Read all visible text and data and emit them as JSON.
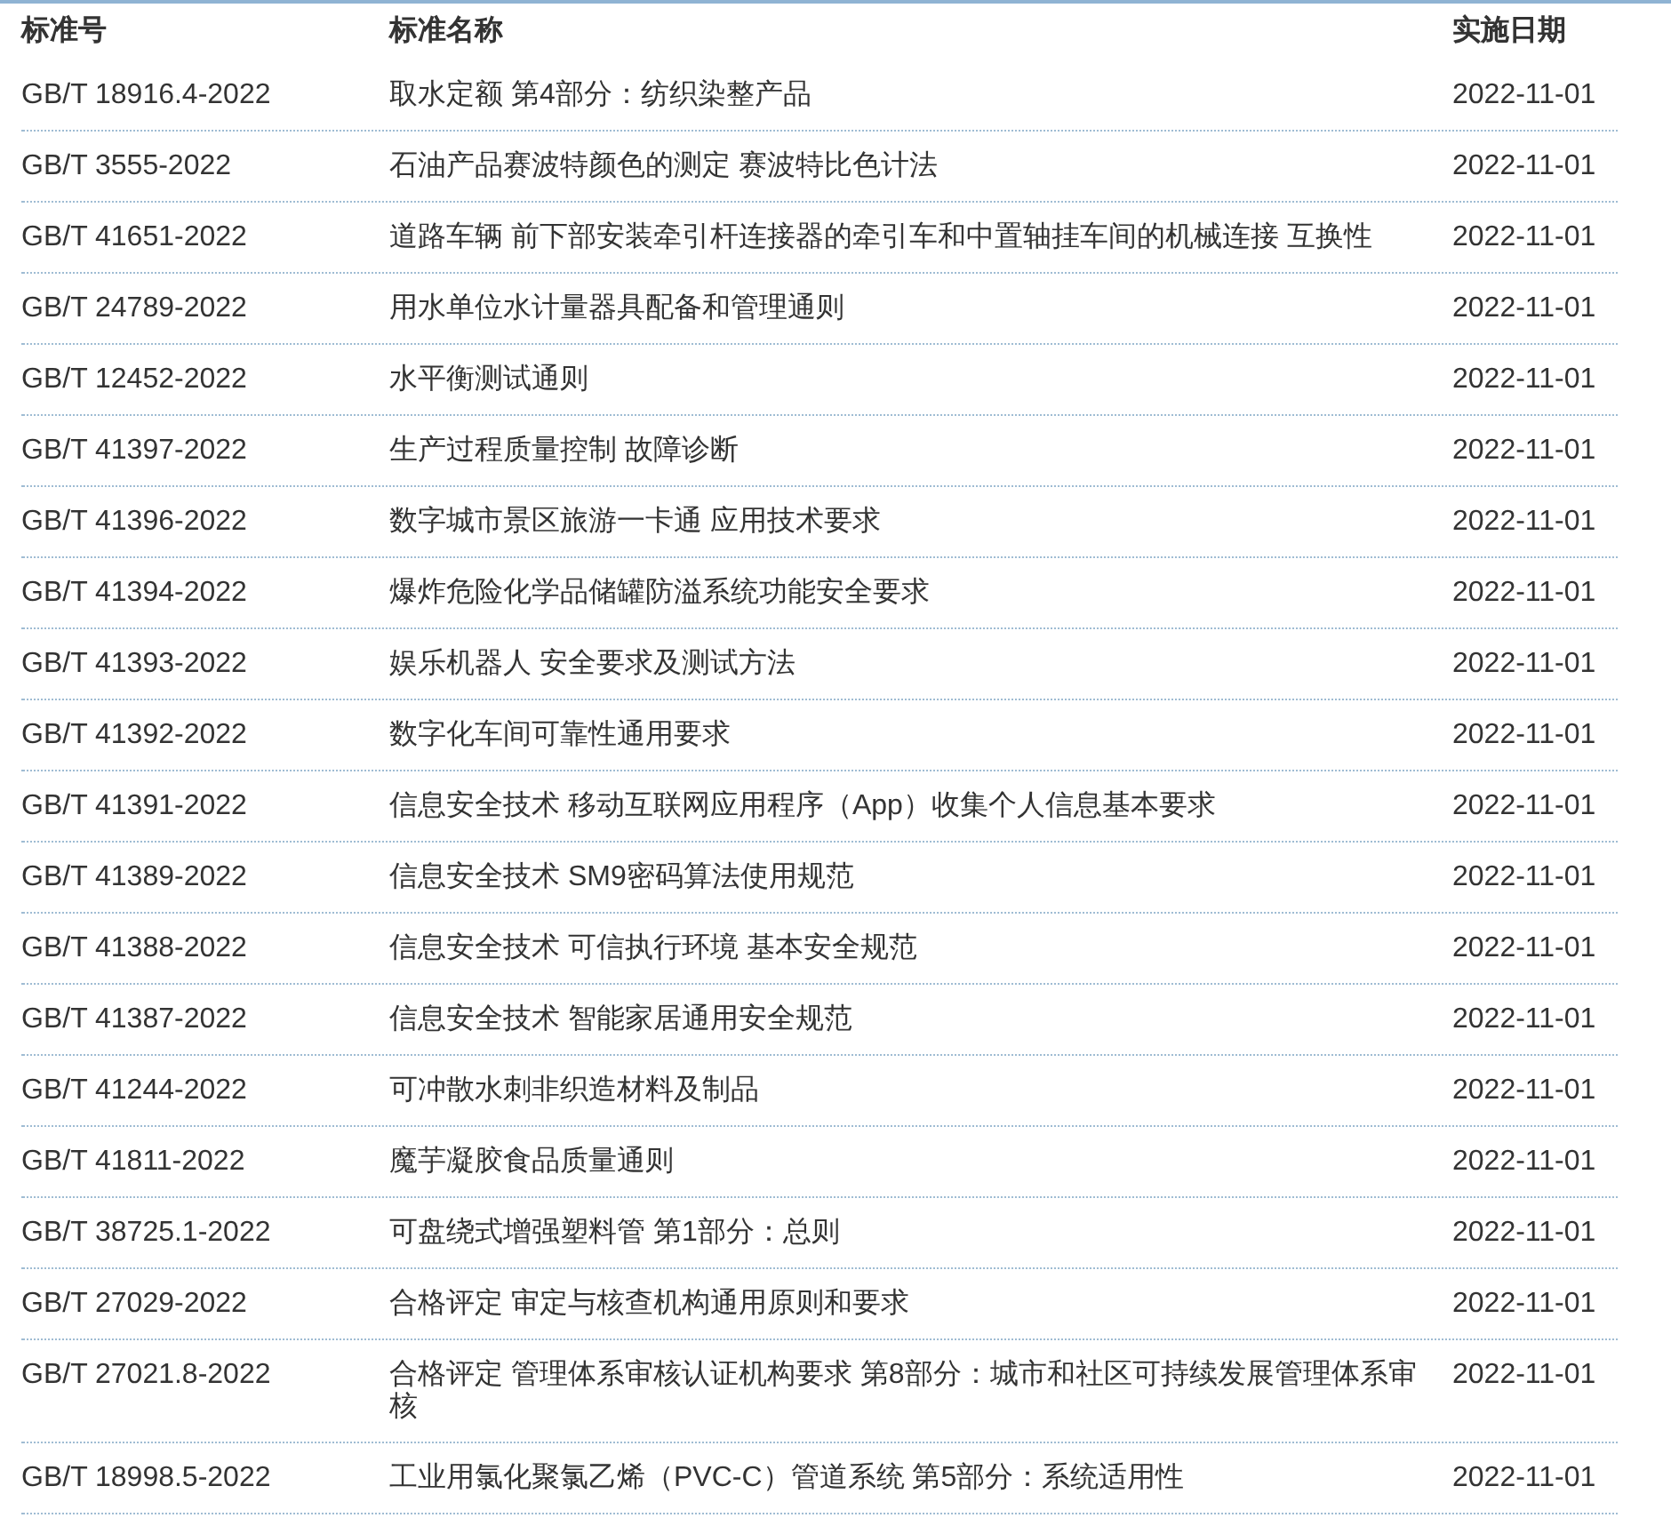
{
  "table": {
    "columns": [
      "标准号",
      "标准名称",
      "实施日期"
    ],
    "rows": [
      {
        "number": "GB/T 18916.4-2022",
        "name": "取水定额 第4部分：纺织染整产品",
        "date": "2022-11-01"
      },
      {
        "number": "GB/T 3555-2022",
        "name": "石油产品赛波特颜色的测定 赛波特比色计法",
        "date": "2022-11-01"
      },
      {
        "number": "GB/T 41651-2022",
        "name": "道路车辆 前下部安装牵引杆连接器的牵引车和中置轴挂车间的机械连接 互换性",
        "date": "2022-11-01"
      },
      {
        "number": "GB/T 24789-2022",
        "name": "用水单位水计量器具配备和管理通则",
        "date": "2022-11-01"
      },
      {
        "number": "GB/T 12452-2022",
        "name": "水平衡测试通则",
        "date": "2022-11-01"
      },
      {
        "number": "GB/T 41397-2022",
        "name": "生产过程质量控制 故障诊断",
        "date": "2022-11-01"
      },
      {
        "number": "GB/T 41396-2022",
        "name": "数字城市景区旅游一卡通 应用技术要求",
        "date": "2022-11-01"
      },
      {
        "number": "GB/T 41394-2022",
        "name": "爆炸危险化学品储罐防溢系统功能安全要求",
        "date": "2022-11-01"
      },
      {
        "number": "GB/T 41393-2022",
        "name": "娱乐机器人 安全要求及测试方法",
        "date": "2022-11-01"
      },
      {
        "number": "GB/T 41392-2022",
        "name": "数字化车间可靠性通用要求",
        "date": "2022-11-01"
      },
      {
        "number": "GB/T 41391-2022",
        "name": "信息安全技术 移动互联网应用程序（App）收集个人信息基本要求",
        "date": "2022-11-01"
      },
      {
        "number": "GB/T 41389-2022",
        "name": "信息安全技术 SM9密码算法使用规范",
        "date": "2022-11-01"
      },
      {
        "number": "GB/T 41388-2022",
        "name": "信息安全技术 可信执行环境 基本安全规范",
        "date": "2022-11-01"
      },
      {
        "number": "GB/T 41387-2022",
        "name": "信息安全技术 智能家居通用安全规范",
        "date": "2022-11-01"
      },
      {
        "number": "GB/T 41244-2022",
        "name": "可冲散水刺非织造材料及制品",
        "date": "2022-11-01"
      },
      {
        "number": "GB/T 41811-2022",
        "name": "魔芋凝胶食品质量通则",
        "date": "2022-11-01"
      },
      {
        "number": "GB/T 38725.1-2022",
        "name": "可盘绕式增强塑料管 第1部分：总则",
        "date": "2022-11-01"
      },
      {
        "number": "GB/T 27029-2022",
        "name": "合格评定 审定与核查机构通用原则和要求",
        "date": "2022-11-01"
      },
      {
        "number": "GB/T 27021.8-2022",
        "name": "合格评定 管理体系审核认证机构要求 第8部分：城市和社区可持续发展管理体系审核",
        "date": "2022-11-01"
      },
      {
        "number": "GB/T 18998.5-2022",
        "name": "工业用氯化聚氯乙烯（PVC-C）管道系统 第5部分：系统适用性",
        "date": "2022-11-01"
      }
    ]
  }
}
